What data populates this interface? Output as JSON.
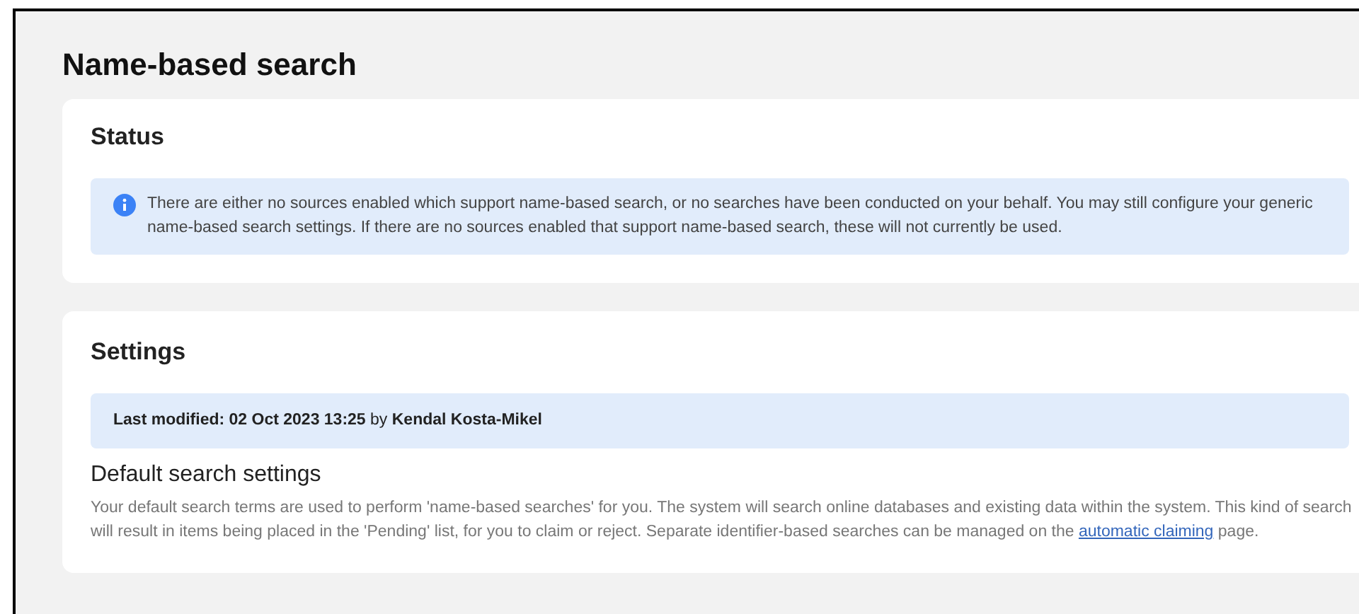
{
  "page_title": "Name-based search",
  "status": {
    "heading": "Status",
    "notice": "There are either no sources enabled which support name-based search, or no searches have been conducted on your behalf. You may still configure your generic name-based search settings. If there are no sources enabled that support name-based search, these will not currently be used."
  },
  "settings": {
    "heading": "Settings",
    "last_modified": "**Last modified: 02 Oct 2023 13:25** by **Kendal Kosta-Mikel**",
    "subheading": "Default search settings",
    "description_before": "Your default search terms are used to perform 'name-based searches' for you. The system will search online databases and existing data within the system. This kind of search will result in items being placed in the 'Pending' list, for you to claim or reject. Separate identifier-based searches can be managed on the",
    "link": "automatic claiming",
    "description_after": "page."
  }
}
